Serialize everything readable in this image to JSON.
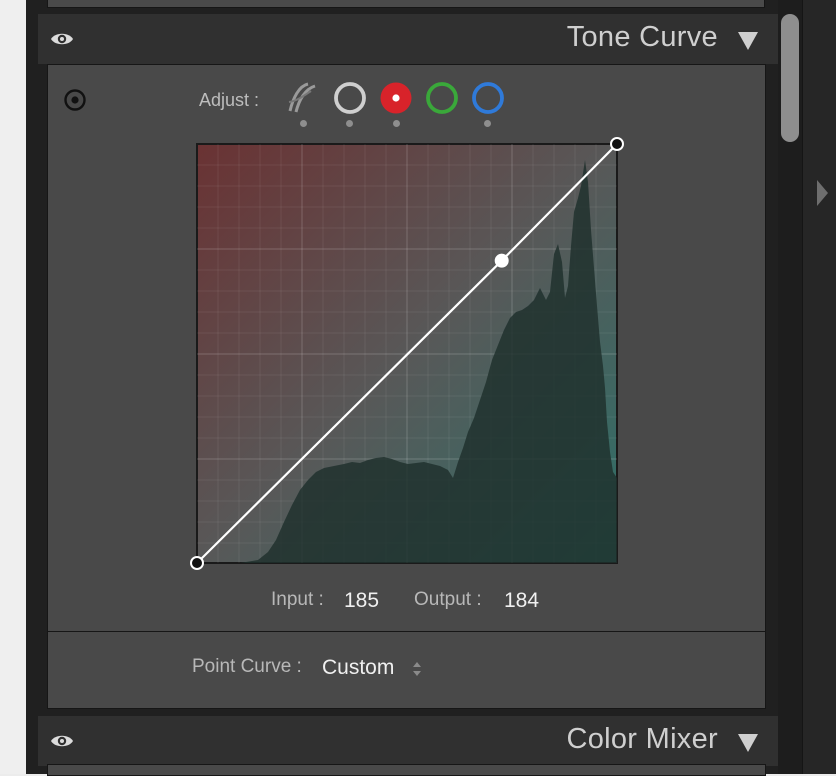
{
  "panels": {
    "tone_curve": {
      "title": "Tone Curve",
      "adjust_label": "Adjust :",
      "channels": [
        {
          "name": "parametric",
          "icon": "parametric-curve-icon",
          "color": "#9a9a9a"
        },
        {
          "name": "rgb",
          "icon": "rgb-channel-icon",
          "color": "#c9c9c9",
          "selected": false
        },
        {
          "name": "red",
          "icon": "red-channel-icon",
          "color": "#d8232a",
          "selected": true
        },
        {
          "name": "green",
          "icon": "green-channel-icon",
          "color": "#3aa83a",
          "selected": false
        },
        {
          "name": "blue",
          "icon": "blue-channel-icon",
          "color": "#2f7ad9",
          "selected": false
        }
      ],
      "curve": {
        "points": [
          [
            0,
            0
          ],
          [
            185,
            184
          ],
          [
            255,
            255
          ]
        ],
        "range": [
          0,
          255
        ]
      },
      "input_label": "Input :",
      "input_value": "185",
      "output_label": "Output :",
      "output_value": "184",
      "point_curve_label": "Point Curve :",
      "point_curve_value": "Custom"
    },
    "color_mixer": {
      "title": "Color Mixer"
    }
  },
  "colors": {
    "panel_bg": "#494949",
    "header_bg": "#303030",
    "red_tint": "#7a2f30",
    "cyan_tint": "#2e7a70"
  }
}
